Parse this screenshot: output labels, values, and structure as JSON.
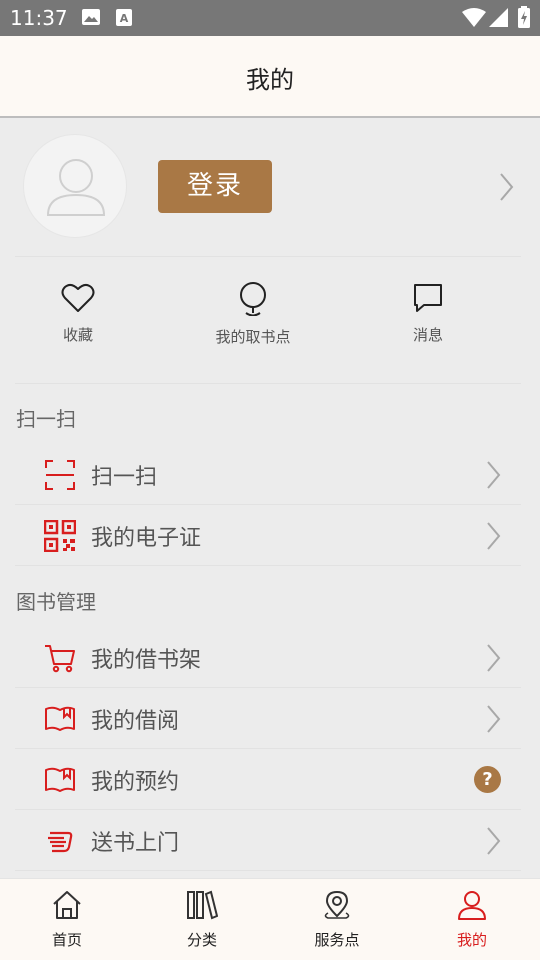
{
  "status_bar": {
    "time": "11:37",
    "icons": [
      "image-icon",
      "a-icon",
      "wifi-icon",
      "signal-icon",
      "battery-icon"
    ]
  },
  "header": {
    "title": "我的"
  },
  "profile": {
    "avatar_icon": "user-icon",
    "login_label": "登录"
  },
  "quick_actions": [
    {
      "label": "收藏",
      "icon": "heart-icon"
    },
    {
      "label": "我的取书点",
      "icon": "location-pin-icon"
    },
    {
      "label": "消息",
      "icon": "message-icon"
    }
  ],
  "sections": [
    {
      "title": "扫一扫",
      "items": [
        {
          "label": "扫一扫",
          "icon": "scan-icon",
          "trailing": "chevron"
        },
        {
          "label": "我的电子证",
          "icon": "qr-code-icon",
          "trailing": "chevron"
        }
      ]
    },
    {
      "title": "图书管理",
      "items": [
        {
          "label": "我的借书架",
          "icon": "cart-icon",
          "trailing": "chevron"
        },
        {
          "label": "我的借阅",
          "icon": "book-icon",
          "trailing": "chevron"
        },
        {
          "label": "我的预约",
          "icon": "book-icon",
          "trailing": "help",
          "help_text": "?"
        },
        {
          "label": "送书上门",
          "icon": "delivery-icon",
          "trailing": "chevron"
        }
      ]
    }
  ],
  "tab_bar": [
    {
      "label": "首页",
      "icon": "home-icon",
      "active": false
    },
    {
      "label": "分类",
      "icon": "books-icon",
      "active": false
    },
    {
      "label": "服务点",
      "icon": "map-pin-icon",
      "active": false
    },
    {
      "label": "我的",
      "icon": "person-icon",
      "active": true
    }
  ],
  "colors": {
    "accent_brown": "#a97845",
    "accent_red": "#d81e1e",
    "header_bg": "#fdf9f4",
    "page_bg": "#ececec",
    "status_bar_bg": "#777777"
  }
}
